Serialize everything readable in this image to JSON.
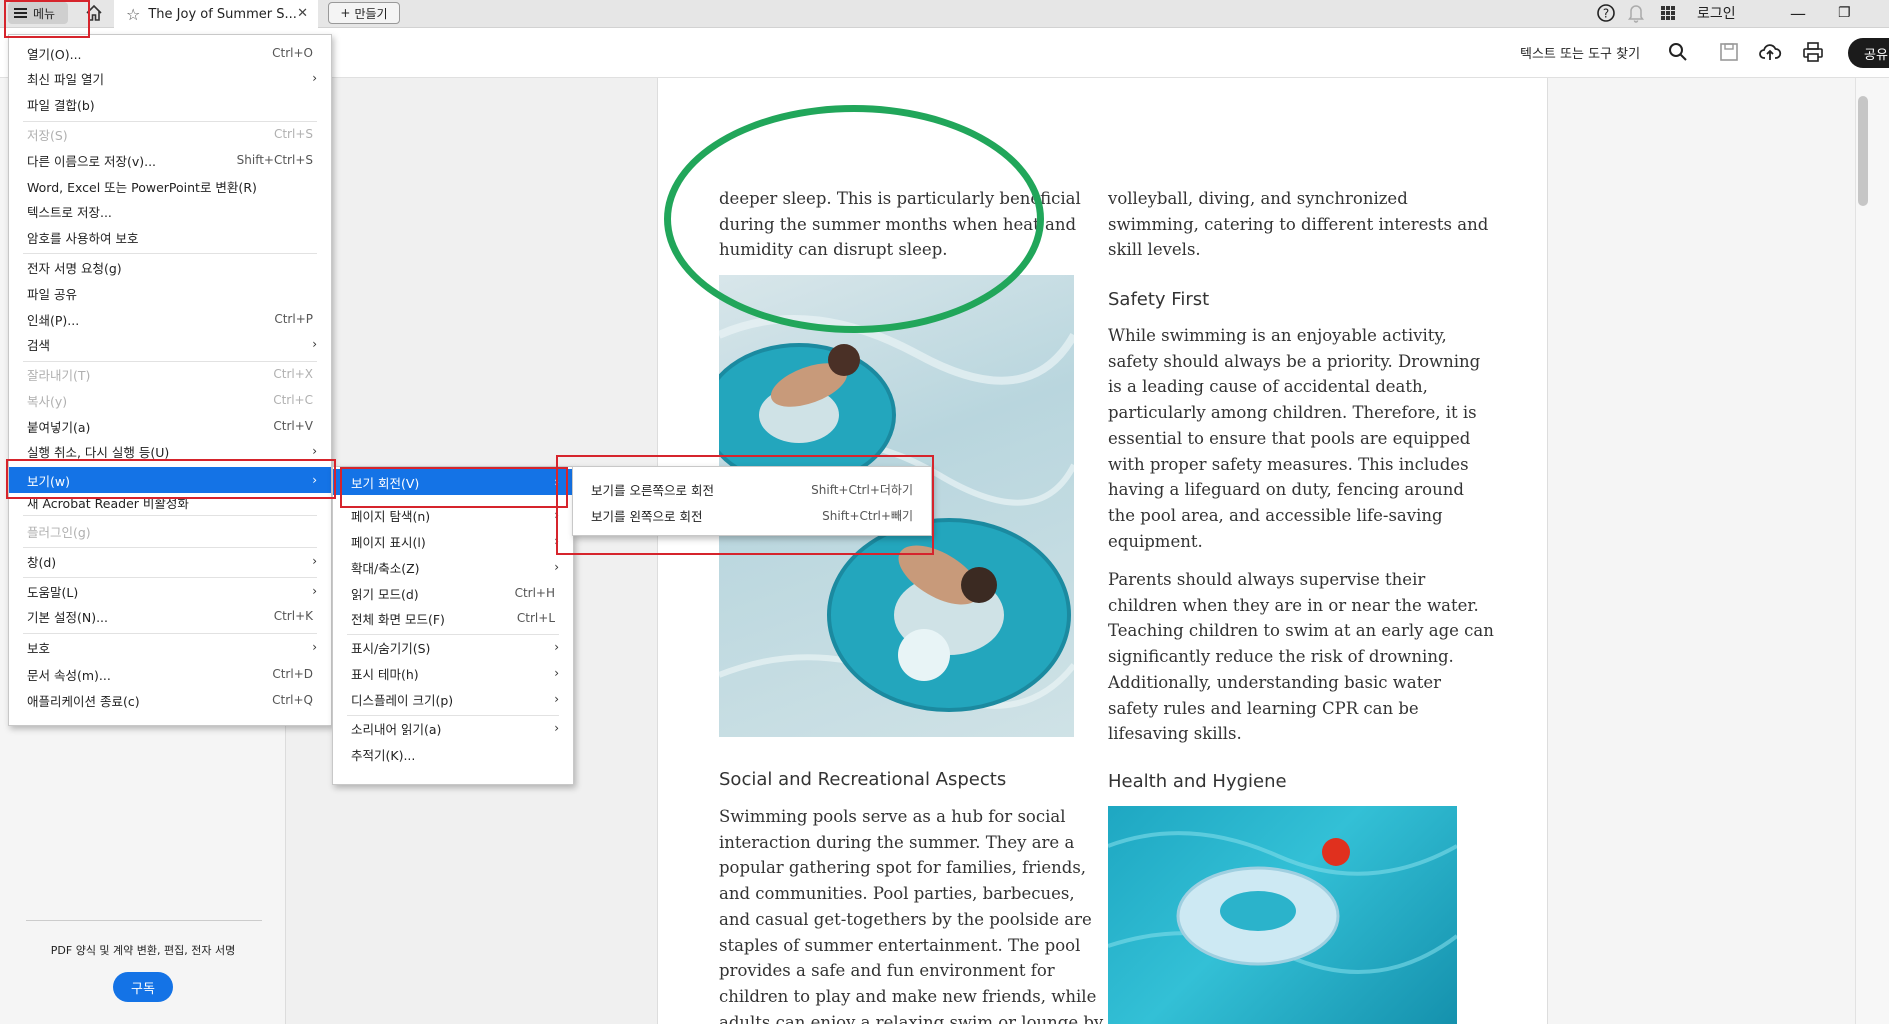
{
  "tabbar": {
    "menu_label": "메뉴",
    "tab_title": "The Joy of Summer S...",
    "new_tab_label": "만들기",
    "login_label": "로그인"
  },
  "toolbar": {
    "find_label": "텍스트 또는 도구 찾기",
    "share_label": "공유"
  },
  "sidebar_promo": {
    "text": "PDF 양식 및 계약 변환, 편집, 전자 서명",
    "button": "구독"
  },
  "main_menu": [
    {
      "label": "열기(O)...",
      "shortcut": "Ctrl+O"
    },
    {
      "label": "최신 파일 열기",
      "submenu": true
    },
    {
      "label": "파일 결합(b)"
    },
    {
      "label": "저장(S)",
      "shortcut": "Ctrl+S",
      "disabled": true
    },
    {
      "label": "다른 이름으로 저장(v)...",
      "shortcut": "Shift+Ctrl+S"
    },
    {
      "label": "Word, Excel 또는 PowerPoint로 변환(R)"
    },
    {
      "label": "텍스트로 저장..."
    },
    {
      "label": "암호를 사용하여 보호"
    },
    {
      "label": "전자 서명 요청(g)"
    },
    {
      "label": "파일 공유"
    },
    {
      "label": "인쇄(P)...",
      "shortcut": "Ctrl+P"
    },
    {
      "label": "검색",
      "submenu": true
    },
    {
      "label": "잘라내기(T)",
      "shortcut": "Ctrl+X",
      "disabled": true
    },
    {
      "label": "복사(y)",
      "shortcut": "Ctrl+C",
      "disabled": true
    },
    {
      "label": "붙여넣기(a)",
      "shortcut": "Ctrl+V"
    },
    {
      "label": "실행 취소, 다시 실행 등(U)",
      "submenu": true
    },
    {
      "label": "보기(w)",
      "submenu": true,
      "active": true
    },
    {
      "label": "새 Acrobat Reader 비활성화"
    },
    {
      "label": "플러그인(g)",
      "disabled": true
    },
    {
      "label": "창(d)",
      "submenu": true
    },
    {
      "label": "도움말(L)",
      "submenu": true
    },
    {
      "label": "기본 설정(N)...",
      "shortcut": "Ctrl+K"
    },
    {
      "label": "보호",
      "submenu": true
    },
    {
      "label": "문서 속성(m)...",
      "shortcut": "Ctrl+D"
    },
    {
      "label": "애플리케이션 종료(c)",
      "shortcut": "Ctrl+Q"
    }
  ],
  "view_menu": [
    {
      "label": "보기 회전(V)",
      "submenu": true,
      "active": true
    },
    {
      "label": "페이지 탐색(n)",
      "submenu": true
    },
    {
      "label": "페이지 표시(l)",
      "submenu": true
    },
    {
      "label": "확대/축소(Z)",
      "submenu": true
    },
    {
      "label": "읽기 모드(d)",
      "shortcut": "Ctrl+H"
    },
    {
      "label": "전체 화면 모드(F)",
      "shortcut": "Ctrl+L"
    },
    {
      "label": "표시/숨기기(S)",
      "submenu": true
    },
    {
      "label": "표시 테마(h)",
      "submenu": true
    },
    {
      "label": "디스플레이 크기(p)",
      "submenu": true
    },
    {
      "label": "소리내어 읽기(a)",
      "submenu": true
    },
    {
      "label": "추적기(K)..."
    }
  ],
  "rotate_menu": [
    {
      "label": "보기를 오른쪽으로 회전",
      "shortcut": "Shift+Ctrl+더하기"
    },
    {
      "label": "보기를 왼쪽으로 회전",
      "shortcut": "Shift+Ctrl+빼기"
    }
  ],
  "document": {
    "col1_para1": [
      "deeper sleep. This is particularly beneficial",
      "during the summer months when heat and",
      "humidity can disrupt sleep."
    ],
    "col1_heading": "Social and Recreational Aspects",
    "col1_para2": [
      "Swimming pools serve as a hub for social",
      "interaction during the summer. They are a",
      "popular gathering spot for families, friends,",
      "and communities. Pool parties, barbecues,",
      "and casual get-togethers by the poolside are",
      "staples of summer entertainment. The pool",
      "provides a safe and fun environment for",
      "children to play and make new friends, while",
      "adults can enjoy a relaxing swim or lounge by"
    ],
    "col2_para1": [
      "volleyball, diving, and synchronized",
      "swimming, catering to different interests and",
      "skill levels."
    ],
    "col2_heading1": "Safety First",
    "col2_para2": [
      "While swimming is an enjoyable activity,",
      "safety should always be a priority. Drowning",
      "is a leading cause of accidental death,",
      "particularly among children. Therefore, it is",
      "essential to ensure that pools are equipped",
      "with proper safety measures. This includes",
      "having a lifeguard on duty, fencing around",
      "the pool area, and accessible life-saving",
      "equipment."
    ],
    "col2_para3": [
      "Parents should always supervise their",
      "children when they are in or near the water.",
      "Teaching children to swim at an early age can",
      "significantly reduce the risk of drowning.",
      "Additionally, understanding basic water",
      "safety rules and learning CPR can be",
      "lifesaving skills."
    ],
    "col2_heading2": "Health and Hygiene"
  },
  "colors": {
    "accent": "#1473e6",
    "highlight_box": "#d6242c",
    "annotation_ellipse": "#21a65a"
  }
}
